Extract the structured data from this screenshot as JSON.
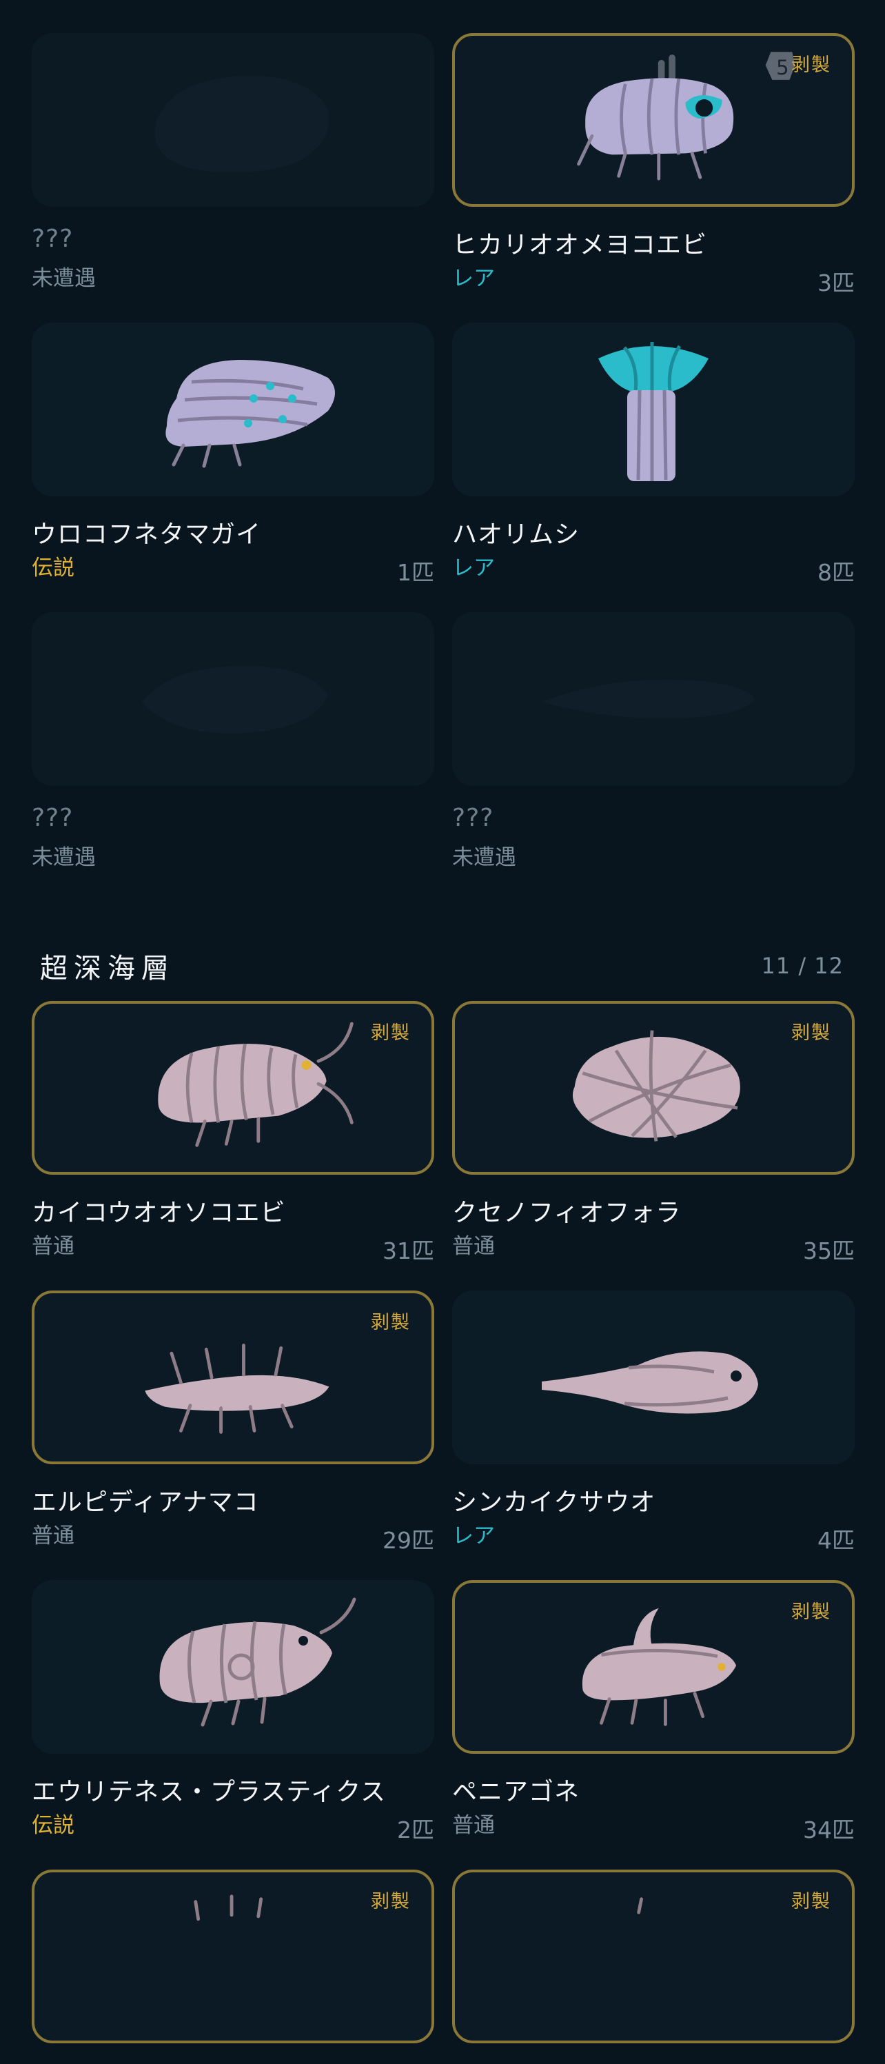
{
  "colors": {
    "background": "#08141e",
    "card": "#0c1c27",
    "specimen_border": "#8a7838",
    "badge": "#d8aa3c",
    "rare": "#2bbccb",
    "legend": "#e0b133",
    "muted": "#7d8f9b"
  },
  "top_grid": [
    {
      "name": "???",
      "rarity": "未遭遇",
      "count": "",
      "badge": "",
      "discovered": false,
      "icon": "unknown-silhouette-icon"
    },
    {
      "name": "ヒカリオオメヨコエビ",
      "rarity": "レア",
      "count": "3匹",
      "badge": "剥製",
      "discovered": true,
      "icon": "glowing-amphipod-icon"
    },
    {
      "name": "ウロコフネタマガイ",
      "rarity": "伝説",
      "count": "1匹",
      "badge": "",
      "discovered": true,
      "icon": "scaly-snail-icon"
    },
    {
      "name": "ハオリムシ",
      "rarity": "レア",
      "count": "8匹",
      "badge": "",
      "discovered": true,
      "icon": "tube-worm-icon"
    },
    {
      "name": "???",
      "rarity": "未遭遇",
      "count": "",
      "badge": "",
      "discovered": false,
      "icon": "unknown-silhouette-icon"
    },
    {
      "name": "???",
      "rarity": "未遭遇",
      "count": "",
      "badge": "",
      "discovered": false,
      "icon": "unknown-silhouette-icon"
    }
  ],
  "section": {
    "title": "超深海層",
    "progress": "11 / 12"
  },
  "hadal_grid": [
    {
      "name": "カイコウオオソコエビ",
      "rarity": "普通",
      "count": "31匹",
      "badge": "剥製",
      "discovered": true,
      "icon": "giant-amphipod-icon"
    },
    {
      "name": "クセノフィオフォラ",
      "rarity": "普通",
      "count": "35匹",
      "badge": "剥製",
      "discovered": true,
      "icon": "xenophyophore-icon"
    },
    {
      "name": "エルピディアナマコ",
      "rarity": "普通",
      "count": "29匹",
      "badge": "剥製",
      "discovered": true,
      "icon": "sea-cucumber-icon"
    },
    {
      "name": "シンカイクサウオ",
      "rarity": "レア",
      "count": "4匹",
      "badge": "",
      "discovered": true,
      "icon": "snailfish-icon"
    },
    {
      "name": "エウリテネス・プラスティクス",
      "rarity": "伝説",
      "count": "2匹",
      "badge": "",
      "discovered": true,
      "icon": "plastic-amphipod-icon"
    },
    {
      "name": "ペニアゴネ",
      "rarity": "普通",
      "count": "34匹",
      "badge": "剥製",
      "discovered": true,
      "icon": "sea-pig-icon"
    },
    {
      "name": "",
      "rarity": "",
      "count": "",
      "badge": "剥製",
      "discovered": true,
      "icon": "partial-creature-icon"
    },
    {
      "name": "",
      "rarity": "",
      "count": "",
      "badge": "剥製",
      "discovered": true,
      "icon": "partial-creature-icon"
    }
  ]
}
